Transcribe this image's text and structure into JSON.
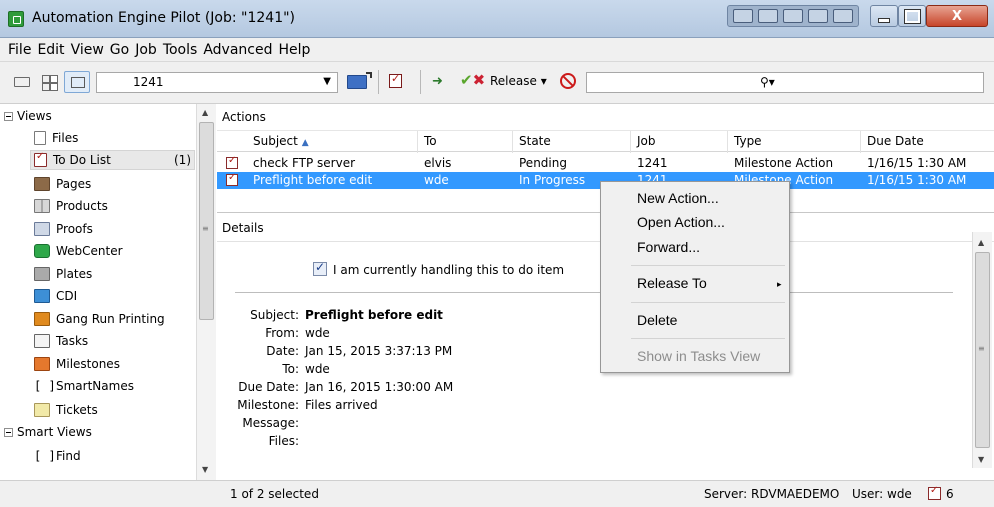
{
  "window": {
    "title": "Automation Engine Pilot (Job: \"1241\")",
    "close_label": "X"
  },
  "menubar": [
    "File",
    "Edit",
    "View",
    "Go",
    "Job",
    "Tools",
    "Advanced",
    "Help"
  ],
  "toolbar": {
    "job_value": "1241",
    "release_label": "Release",
    "release_arrow": "▾",
    "search_value": "",
    "search_glyph": "⚲▾"
  },
  "sidebar": {
    "views_header": "Views",
    "items": [
      {
        "label": "Files",
        "icon": "file-icon"
      },
      {
        "label": "To Do List",
        "icon": "todo-icon",
        "count": "(1)"
      },
      {
        "label": "Pages",
        "icon": "pages-icon"
      },
      {
        "label": "Products",
        "icon": "products-icon"
      },
      {
        "label": "Proofs",
        "icon": "proofs-icon"
      },
      {
        "label": "WebCenter",
        "icon": "webcenter-icon"
      },
      {
        "label": "Plates",
        "icon": "plates-icon"
      },
      {
        "label": "CDI",
        "icon": "cdi-icon"
      },
      {
        "label": "Gang Run Printing",
        "icon": "gang-run-icon"
      },
      {
        "label": "Tasks",
        "icon": "tasks-icon"
      },
      {
        "label": "Milestones",
        "icon": "milestones-icon"
      },
      {
        "label": "SmartNames",
        "icon": "smartnames-icon",
        "glyph": "[ ]"
      },
      {
        "label": "Tickets",
        "icon": "tickets-icon"
      }
    ],
    "smart_views_header": "Smart Views",
    "smart_items": [
      {
        "label": "Find",
        "icon": "find-icon",
        "glyph": "[ ]"
      }
    ]
  },
  "actions": {
    "label": "Actions",
    "columns": [
      "Subject",
      "To",
      "State",
      "Job",
      "Type",
      "Due Date"
    ],
    "sort_glyph": "▲",
    "rows": [
      {
        "subject": "check FTP server",
        "to": "elvis",
        "state": "Pending",
        "job": "1241",
        "type": "Milestone Action",
        "due": "1/16/15 1:30 AM"
      },
      {
        "subject": "Preflight before edit",
        "to": "wde",
        "state": "In Progress",
        "job": "1241",
        "type": "Milestone Action",
        "due": "1/16/15 1:30 AM"
      }
    ]
  },
  "details": {
    "label": "Details",
    "handling_text": "I am currently handling this to do item",
    "fields": [
      {
        "label": "Subject:",
        "value": "Preflight before edit",
        "bold": true
      },
      {
        "label": "From:",
        "value": "wde"
      },
      {
        "label": "Date:",
        "value": "Jan 15, 2015 3:37:13 PM"
      },
      {
        "label": "To:",
        "value": "wde"
      },
      {
        "label": "Due Date:",
        "value": "Jan 16, 2015 1:30:00 AM"
      },
      {
        "label": "Milestone:",
        "value": "Files arrived"
      },
      {
        "label": "Message:",
        "value": ""
      },
      {
        "label": "Files:",
        "value": ""
      }
    ]
  },
  "context_menu": {
    "items": [
      {
        "label": "New Action...",
        "enabled": true
      },
      {
        "label": "Open Action...",
        "enabled": true
      },
      {
        "label": "Forward...",
        "enabled": true
      },
      {
        "label": "Release To",
        "enabled": true,
        "submenu": true
      },
      {
        "label": "Delete",
        "enabled": true
      },
      {
        "label": "Show in Tasks View",
        "enabled": false
      }
    ],
    "submenu_glyph": "▸"
  },
  "statusbar": {
    "selection": "1 of 2 selected",
    "server": "Server: RDVMAEDEMO",
    "user": "User: wde",
    "todo_count": "6"
  },
  "colors": {
    "selection": "#3399ff",
    "titlebar": "#c9d9ec",
    "close_button": "#c7452a"
  }
}
